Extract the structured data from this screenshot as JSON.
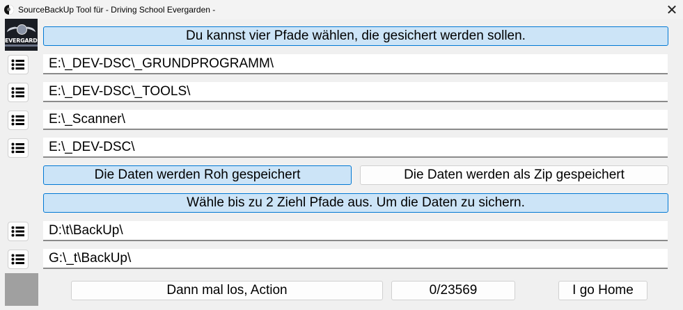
{
  "window": {
    "title": "SourceBackUp Tool für - Driving School Evergarden -",
    "close_glyph": "✕",
    "app_icon": "yin-yang-icon"
  },
  "logo": {
    "text": "EVERGARDEN"
  },
  "source_section": {
    "banner": "Du kannst vier Pfade wählen, die gesichert werden sollen.",
    "paths": [
      "E:\\_DEV-DSC\\_GRUNDPROGRAMM\\",
      "E:\\_DEV-DSC\\_TOOLS\\",
      "E:\\_Scanner\\",
      "E:\\_DEV-DSC\\"
    ],
    "browse_icon": "list-icon"
  },
  "mode_options": {
    "raw_label": "Die Daten werden Roh gespeichert",
    "zip_label": "Die Daten werden als Zip gespeichert",
    "selected": "raw"
  },
  "target_section": {
    "banner": "Wähle bis zu 2 Ziehl Pfade aus. Um die Daten zu sichern.",
    "paths": [
      "D:\\t\\BackUp\\",
      "G:\\_t\\BackUp\\"
    ]
  },
  "footer": {
    "action_label": "Dann mal los, Action",
    "progress_text": "0/23569",
    "home_label": "I go Home"
  },
  "colors": {
    "accent_border": "#0078d4",
    "accent_fill": "#cce4f7",
    "background": "#f0f0f0"
  }
}
